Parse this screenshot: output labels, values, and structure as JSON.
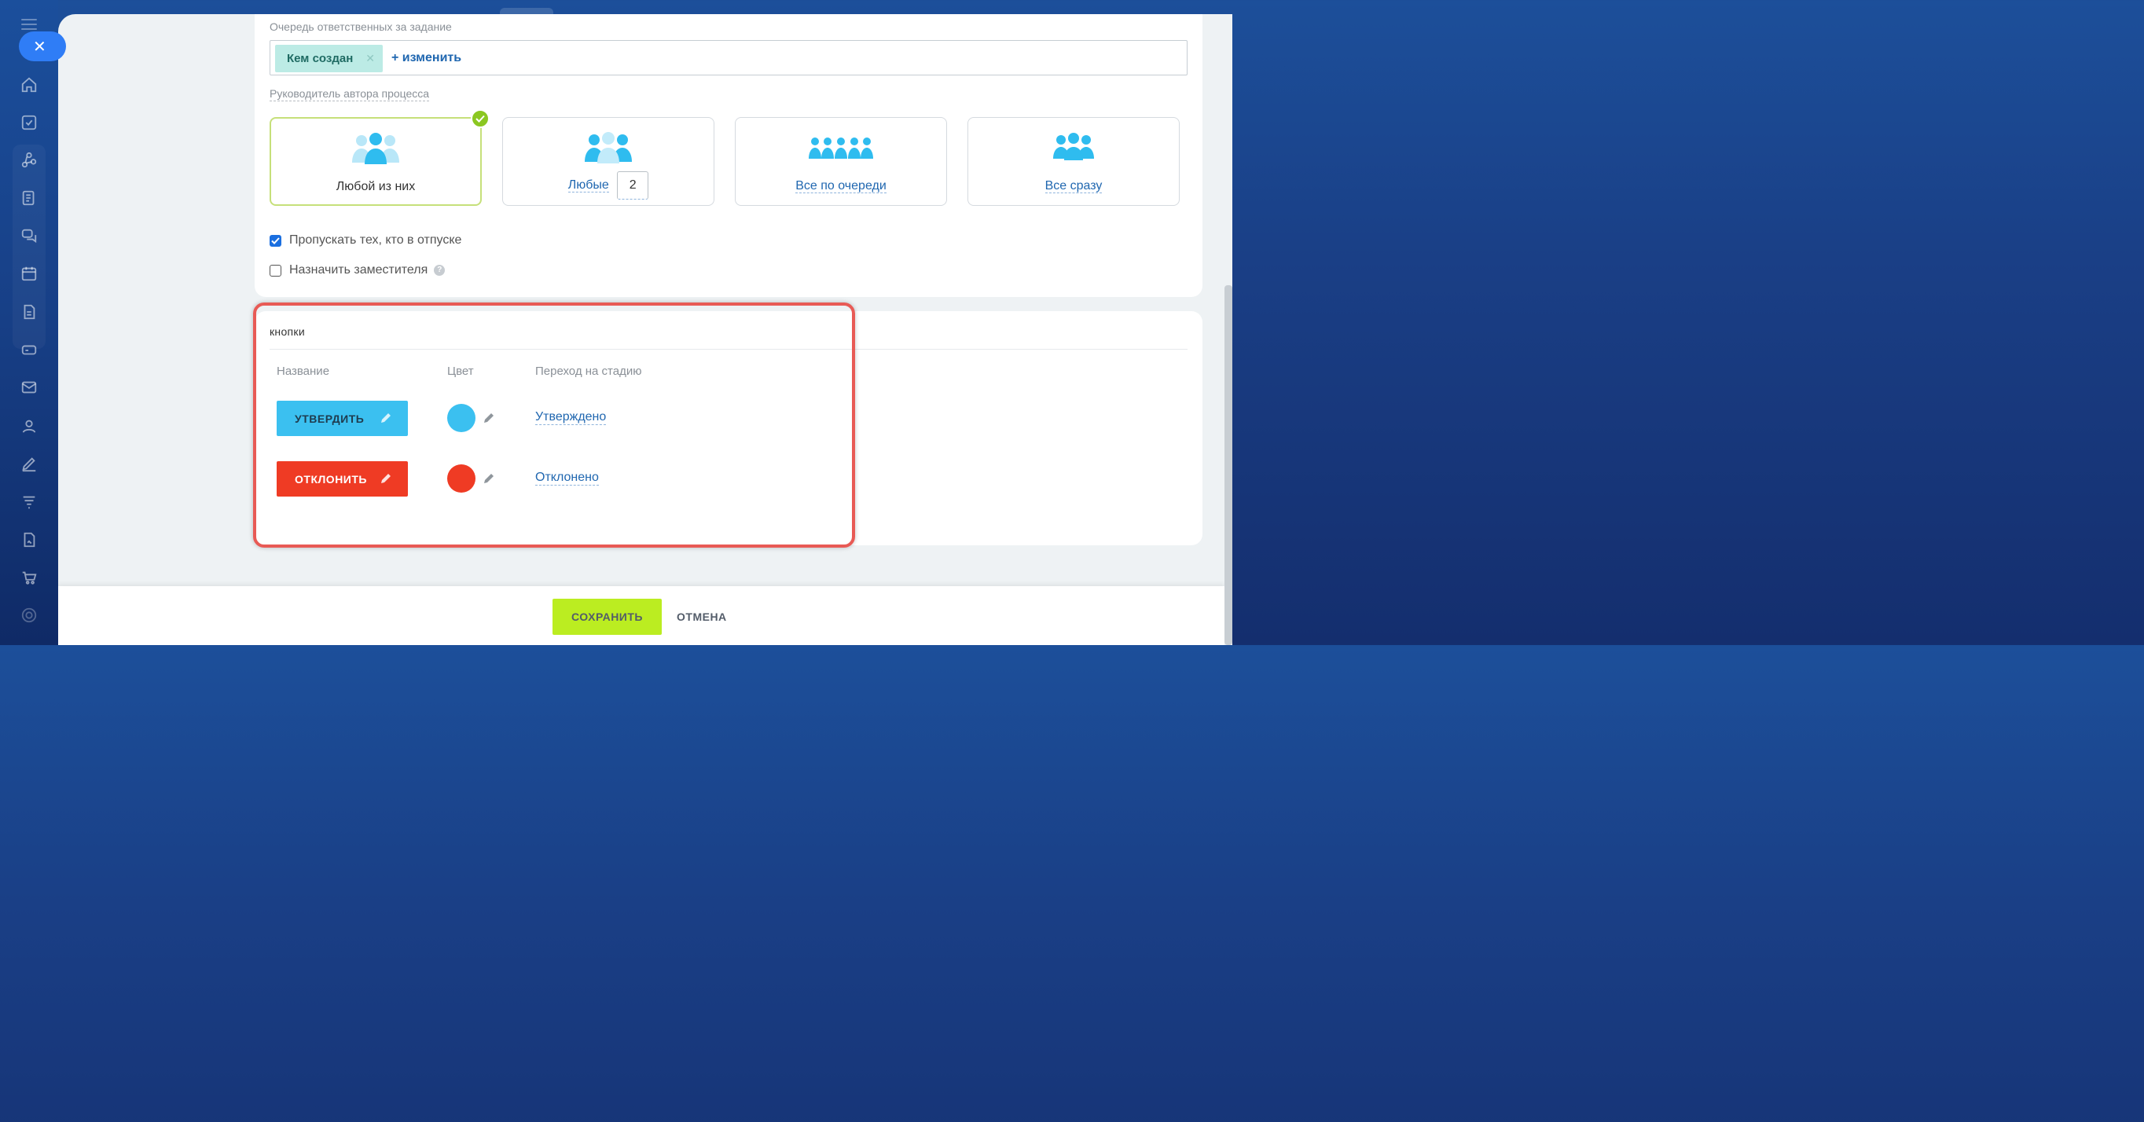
{
  "top": {
    "close_icon": "close-icon"
  },
  "assignment": {
    "queue_label": "Очередь ответственных за задание",
    "chip_label": "Кем создан",
    "change_link": "+ изменить",
    "head_label": "Руководитель автора процесса",
    "options": [
      {
        "label": "Любой из них",
        "selected": true
      },
      {
        "label": "Любые",
        "count": "2",
        "selected": false
      },
      {
        "label": "Все по очереди",
        "selected": false
      },
      {
        "label": "Все сразу",
        "selected": false
      }
    ],
    "skip_vacation": {
      "label": "Пропускать тех, кто в отпуске",
      "checked": true
    },
    "deputy": {
      "label": "Назначить заместителя",
      "checked": false,
      "help": "?"
    }
  },
  "buttons_section": {
    "title": "кнопки",
    "col_name": "Название",
    "col_color": "Цвет",
    "col_stage": "Переход на стадию",
    "rows": [
      {
        "label": "УТВЕРДИТЬ",
        "color": "#3bc0f0",
        "stage": "Утверждено"
      },
      {
        "label": "ОТКЛОНИТЬ",
        "color": "#ef3b24",
        "stage": "Отклонено"
      }
    ]
  },
  "footer": {
    "save_label": "СОХРАНИТЬ",
    "cancel_label": "ОТМЕНА"
  },
  "colors": {
    "accent_blue": "#2067b0",
    "selected_border": "#c6e07a",
    "check_green": "#8bc721",
    "save_green": "#bbed21",
    "highlight_red": "#e85a55"
  }
}
